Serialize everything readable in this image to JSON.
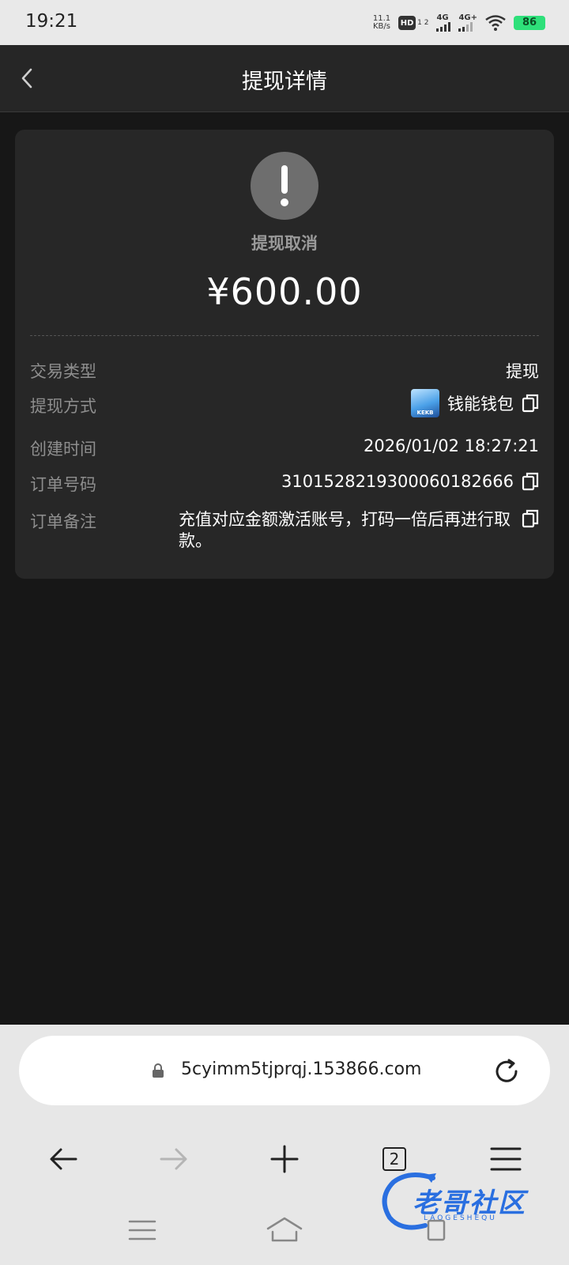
{
  "status_bar": {
    "time": "19:21",
    "net_speed_value": "11.1",
    "net_speed_unit": "KB/s",
    "hd_label": "HD",
    "hd_sub": "1 2",
    "sig1_label": "4G",
    "sig2_label": "4G+",
    "battery": "86",
    "battery_color": "#2ee07a"
  },
  "header": {
    "title": "提现详情",
    "back_icon": "chevron-left-icon"
  },
  "card": {
    "status_icon": "exclamation-icon",
    "status_text": "提现取消",
    "amount": "¥600.00",
    "rows": [
      {
        "label": "交易类型",
        "value": "提现"
      },
      {
        "label": "提现方式",
        "value": "钱能钱包"
      },
      {
        "label": "创建时间",
        "value": "2026/01/02 18:27:21"
      },
      {
        "label": "订单号码",
        "value": "3101528219300060182666"
      },
      {
        "label": "订单备注",
        "value": "充值对应金额激活账号，打码一倍后再进行取款。"
      }
    ],
    "wallet_logo_text": "KEKB"
  },
  "browser": {
    "url": "5cyimm5tjprqj.153866.com",
    "tab_count": "2"
  },
  "watermark": {
    "text": "老哥社区",
    "sub": "LAOGESHEQU"
  }
}
